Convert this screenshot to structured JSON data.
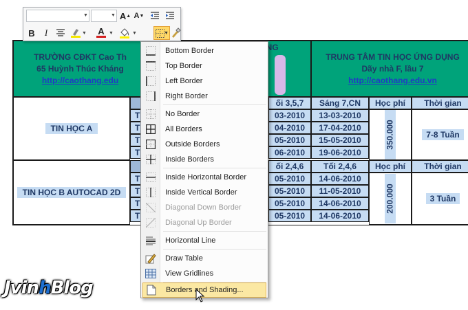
{
  "doc": {
    "left_school": "TRƯỜNG CĐKT Cao Th",
    "left_address": "65 Huỳnh Thúc Kháng",
    "left_url": "http://caothang.edu",
    "mid_title": "ẮNG",
    "right_title": "TRUNG TÂM TIN HỌC ỨNG DỤNG",
    "right_address": "Dãy nhà F, lầu 7",
    "right_url": "http://caothang.edu.vn",
    "course_a": "TIN HỌC A",
    "course_b": "TIN HỌC B AUTOCAD 2D",
    "row_prefix": "T",
    "section_a": {
      "h1": "ối 3,5,7",
      "h2": "Sáng 7,CN",
      "h3": "Học phí",
      "h4": "Thời gian",
      "rows": [
        [
          "03-2010",
          "13-03-2010"
        ],
        [
          "04-2010",
          "17-04-2010"
        ],
        [
          "05-2010",
          "15-05-2010"
        ],
        [
          "06-2010",
          "19-06-2010"
        ]
      ],
      "fee": "350.000",
      "duration": "7-8 Tuần"
    },
    "section_b": {
      "h1": "ối 2,4,6",
      "h2": "Tối 2,4,6",
      "h3": "Học phí",
      "h4": "Thời gian",
      "rows": [
        [
          "05-2010",
          "14-06-2010"
        ],
        [
          "05-2010",
          "11-05-2010"
        ],
        [
          "05-2010",
          "14-06-2010"
        ],
        [
          "05-2010",
          "14-06-2010"
        ]
      ],
      "fee": "200.000",
      "duration": "3 Tuần"
    }
  },
  "toolbar": {
    "grow_font": "A",
    "shrink_font": "A",
    "bold": "B",
    "italic": "I",
    "font_color": "A"
  },
  "menu": {
    "items": [
      {
        "label": "Bottom Border",
        "icon": "bottom-border-icon"
      },
      {
        "label": "Top Border",
        "icon": "top-border-icon"
      },
      {
        "label": "Left Border",
        "icon": "left-border-icon"
      },
      {
        "label": "Right Border",
        "icon": "right-border-icon"
      },
      {
        "label": "No Border",
        "icon": "no-border-icon"
      },
      {
        "label": "All Borders",
        "icon": "all-borders-icon"
      },
      {
        "label": "Outside Borders",
        "icon": "outside-borders-icon"
      },
      {
        "label": "Inside Borders",
        "icon": "inside-borders-icon"
      },
      {
        "label": "Inside Horizontal Border",
        "icon": "inside-horizontal-border-icon"
      },
      {
        "label": "Inside Vertical Border",
        "icon": "inside-vertical-border-icon"
      },
      {
        "label": "Diagonal Down Border",
        "icon": "diagonal-down-border-icon",
        "disabled": true
      },
      {
        "label": "Diagonal Up Border",
        "icon": "diagonal-up-border-icon",
        "disabled": true
      },
      {
        "label": "Horizontal Line",
        "icon": "horizontal-line-icon"
      },
      {
        "label": "Draw Table",
        "icon": "draw-table-icon"
      },
      {
        "label": "View Gridlines",
        "icon": "view-gridlines-icon"
      },
      {
        "label": "Borders and Shading...",
        "icon": "borders-shading-icon",
        "highlighted": true
      }
    ]
  },
  "logo": {
    "part1": "Jvin",
    "part2": "h",
    "part3": "Blog"
  },
  "colors": {
    "header_green": "#00a37a",
    "cell_blue": "#c6dcf3",
    "menu_highlight": "#fbe8a3"
  }
}
